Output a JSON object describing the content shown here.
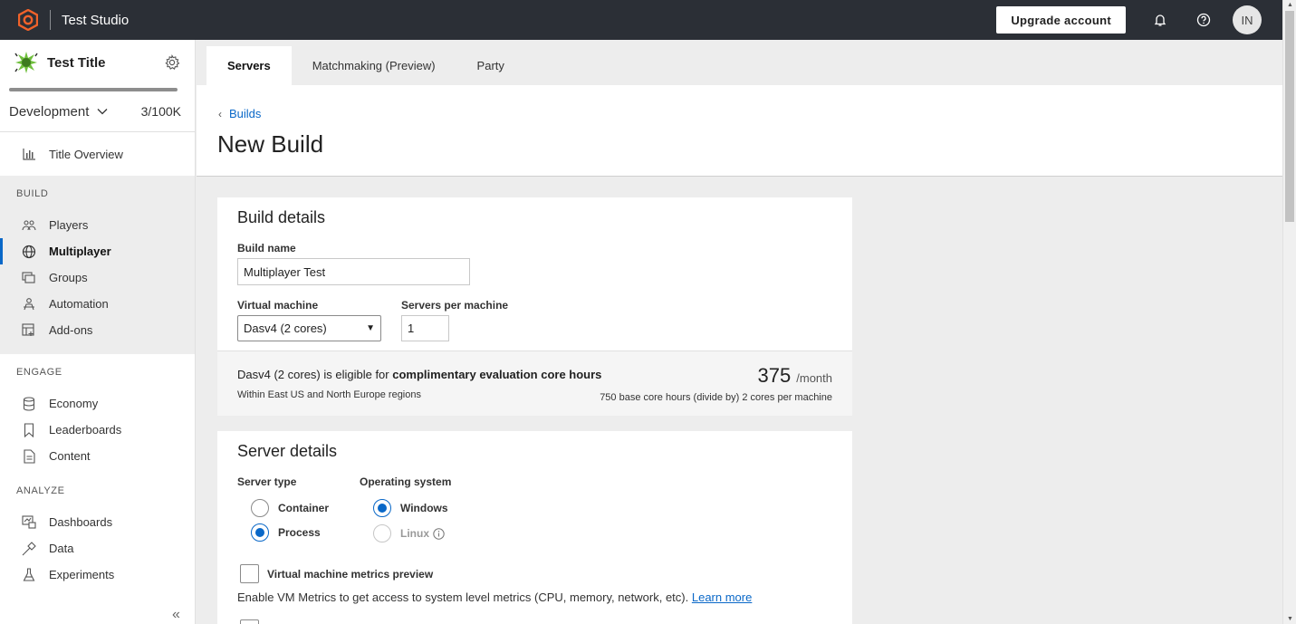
{
  "app": {
    "name": "Test Studio"
  },
  "topbar": {
    "upgrade_label": "Upgrade account",
    "avatar_initials": "IN"
  },
  "sidebar": {
    "title": "Test Title",
    "environment": "Development",
    "usage": "3/100K",
    "overview_label": "Title Overview",
    "sections": {
      "build": {
        "header": "BUILD",
        "items": [
          "Players",
          "Multiplayer",
          "Groups",
          "Automation",
          "Add-ons"
        ]
      },
      "engage": {
        "header": "ENGAGE",
        "items": [
          "Economy",
          "Leaderboards",
          "Content"
        ]
      },
      "analyze": {
        "header": "ANALYZE",
        "items": [
          "Dashboards",
          "Data",
          "Experiments"
        ]
      }
    },
    "active_item": "Multiplayer",
    "collapse_glyph": "«"
  },
  "tabs": [
    {
      "label": "Servers",
      "active": true
    },
    {
      "label": "Matchmaking (Preview)",
      "active": false
    },
    {
      "label": "Party",
      "active": false
    }
  ],
  "page": {
    "back_label": "Builds",
    "title": "New Build"
  },
  "build_details": {
    "title": "Build details",
    "build_name_label": "Build name",
    "build_name_value": "Multiplayer Test",
    "vm_label": "Virtual machine",
    "vm_value": "Dasv4 (2 cores)",
    "servers_label": "Servers per machine",
    "servers_value": "1",
    "eval_text_prefix": "Dasv4 (2 cores) is eligible for ",
    "eval_text_bold": "complimentary evaluation core hours",
    "eval_sub": "Within East US and North Europe regions",
    "eval_value": "375",
    "eval_unit": "/month",
    "eval_calc": "750 base core hours (divide by) 2 cores per machine"
  },
  "server_details": {
    "title": "Server details",
    "server_type_label": "Server type",
    "server_types": [
      {
        "label": "Container",
        "selected": false
      },
      {
        "label": "Process",
        "selected": true
      }
    ],
    "os_label": "Operating system",
    "os_options": [
      {
        "label": "Windows",
        "selected": true,
        "disabled": false
      },
      {
        "label": "Linux",
        "selected": false,
        "disabled": true
      }
    ],
    "vm_metrics_label": "Virtual machine metrics preview",
    "vm_metrics_checked": false,
    "vm_metrics_help": "Enable VM Metrics to get access to system level metrics (CPU, memory, network, etc).",
    "learn_more": "Learn more"
  },
  "colors": {
    "accent": "#0a68c8",
    "topbar": "#2b2f36",
    "logo": "#f0622a"
  }
}
